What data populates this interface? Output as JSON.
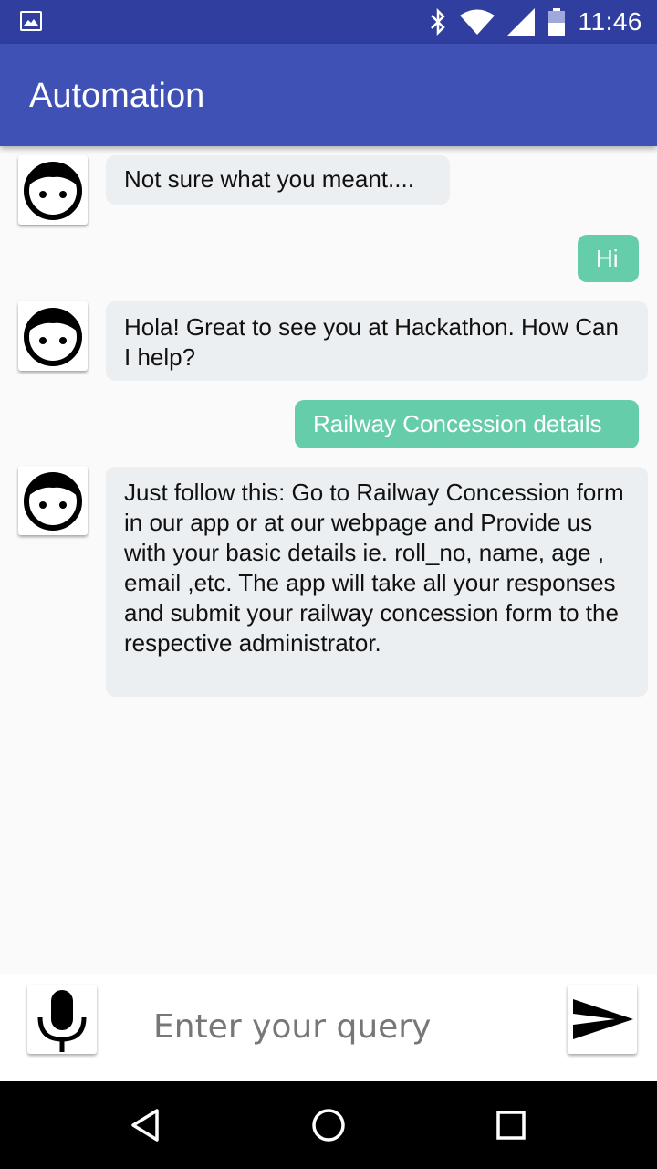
{
  "status_bar": {
    "time": "11:46",
    "icons": [
      "image-icon",
      "bluetooth-icon",
      "wifi-icon",
      "signal-icon",
      "battery-icon"
    ]
  },
  "app_bar": {
    "title": "Automation",
    "color": "#3f51b5"
  },
  "messages": [
    {
      "sender": "bot",
      "text": "Not sure what you meant...."
    },
    {
      "sender": "user",
      "text": "Hi"
    },
    {
      "sender": "bot",
      "text": "Hola! Great to see you at Hackathon. How Can I help?"
    },
    {
      "sender": "user",
      "text": "Railway Concession details"
    },
    {
      "sender": "bot",
      "text": "Just follow this:  Go to Railway Concession form in our app or at our webpage and Provide us with your basic details ie. roll_no, name, age , email ,etc. The app will take  all your responses and submit your railway concession form to the respective administrator."
    }
  ],
  "input": {
    "placeholder": "Enter your query",
    "value": "",
    "mic_icon": "microphone-icon",
    "send_icon": "send-icon"
  },
  "nav_bar": {
    "icons": [
      "back-icon",
      "home-icon",
      "recents-icon"
    ]
  },
  "colors": {
    "status_bar": "#303f9f",
    "user_bubble": "#66cdaa",
    "bot_bubble": "#eceff1"
  }
}
